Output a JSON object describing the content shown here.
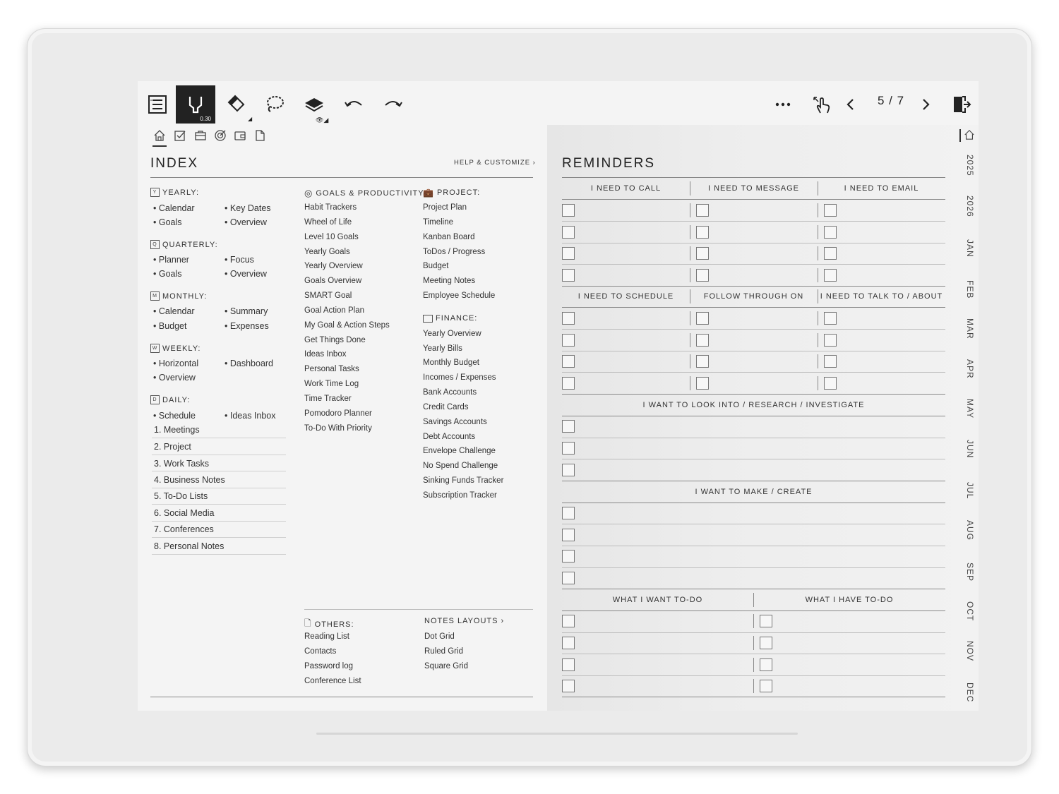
{
  "toolbar": {
    "pen_size": "0.30",
    "page_indicator": "5 / 7"
  },
  "index": {
    "title": "INDEX",
    "help": "HELP & CUSTOMIZE",
    "yearly": {
      "label": "YEARLY:",
      "icon_letter": "Y",
      "items": [
        "Calendar",
        "Key Dates",
        "Goals",
        "Overview"
      ]
    },
    "quarterly": {
      "label": "QUARTERLY:",
      "icon_letter": "Q",
      "items": [
        "Planner",
        "Focus",
        "Goals",
        "Overview"
      ]
    },
    "monthly": {
      "label": "MONTHLY:",
      "icon_letter": "M",
      "items": [
        "Calendar",
        "Summary",
        "Budget",
        "Expenses"
      ]
    },
    "weekly": {
      "label": "WEEKLY:",
      "icon_letter": "W",
      "items": [
        "Horizontal",
        "Dashboard",
        "Overview"
      ]
    },
    "daily": {
      "label": "DAILY:",
      "icon_letter": "D",
      "items": [
        "Schedule",
        "Ideas Inbox"
      ],
      "numbered": [
        "1. Meetings",
        "2. Project",
        "3. Work Tasks",
        "4. Business Notes",
        "5. To-Do Lists",
        "6. Social Media",
        "7. Conferences",
        "8. Personal Notes"
      ]
    },
    "goals": {
      "label": "GOALS & PRODUCTIVITY:",
      "items": [
        "Habit Trackers",
        "Wheel of Life",
        "Level 10 Goals",
        "Yearly Goals",
        "Yearly Overview",
        "Goals Overview",
        "SMART Goal",
        "Goal Action Plan",
        "My Goal & Action Steps",
        "Get Things Done",
        "Ideas Inbox",
        "Personal Tasks",
        "Work Time Log",
        "Time Tracker",
        "Pomodoro Planner",
        "To-Do With Priority"
      ]
    },
    "project": {
      "label": "PROJECT:",
      "items": [
        "Project Plan",
        "Timeline",
        "Kanban Board",
        "ToDos / Progress",
        "Budget",
        "Meeting Notes",
        "Employee Schedule"
      ]
    },
    "finance": {
      "label": "FINANCE:",
      "items": [
        "Yearly Overview",
        "Yearly Bills",
        "Monthly Budget",
        "Incomes / Expenses",
        "Bank Accounts",
        "Credit Cards",
        "Savings Accounts",
        "Debt Accounts",
        "Envelope Challenge",
        "No Spend Challenge",
        "Sinking Funds Tracker",
        "Subscription Tracker"
      ]
    },
    "others": {
      "label": "OTHERS:",
      "items": [
        "Reading List",
        "Contacts",
        "Password log",
        "Conference List"
      ]
    },
    "notes": {
      "label": "NOTES LAYOUTS",
      "items": [
        "Dot Grid",
        "Ruled Grid",
        "Square Grid"
      ]
    }
  },
  "reminders": {
    "title": "REMINDERS",
    "row1_headers": [
      "I NEED TO CALL",
      "I NEED TO MESSAGE",
      "I NEED TO EMAIL"
    ],
    "row2_headers": [
      "I NEED TO SCHEDULE",
      "FOLLOW THROUGH ON",
      "I NEED TO TALK TO / ABOUT"
    ],
    "look_into": "I WANT TO LOOK INTO / RESEARCH / INVESTIGATE",
    "make_create": "I WANT TO MAKE / CREATE",
    "todo_headers": [
      "WHAT I WANT TO-DO",
      "WHAT I HAVE TO-DO"
    ]
  },
  "side_tabs": [
    "2025",
    "2026",
    "JAN",
    "FEB",
    "MAR",
    "APR",
    "MAY",
    "JUN",
    "JUL",
    "AUG",
    "SEP",
    "OCT",
    "NOV",
    "DEC"
  ]
}
